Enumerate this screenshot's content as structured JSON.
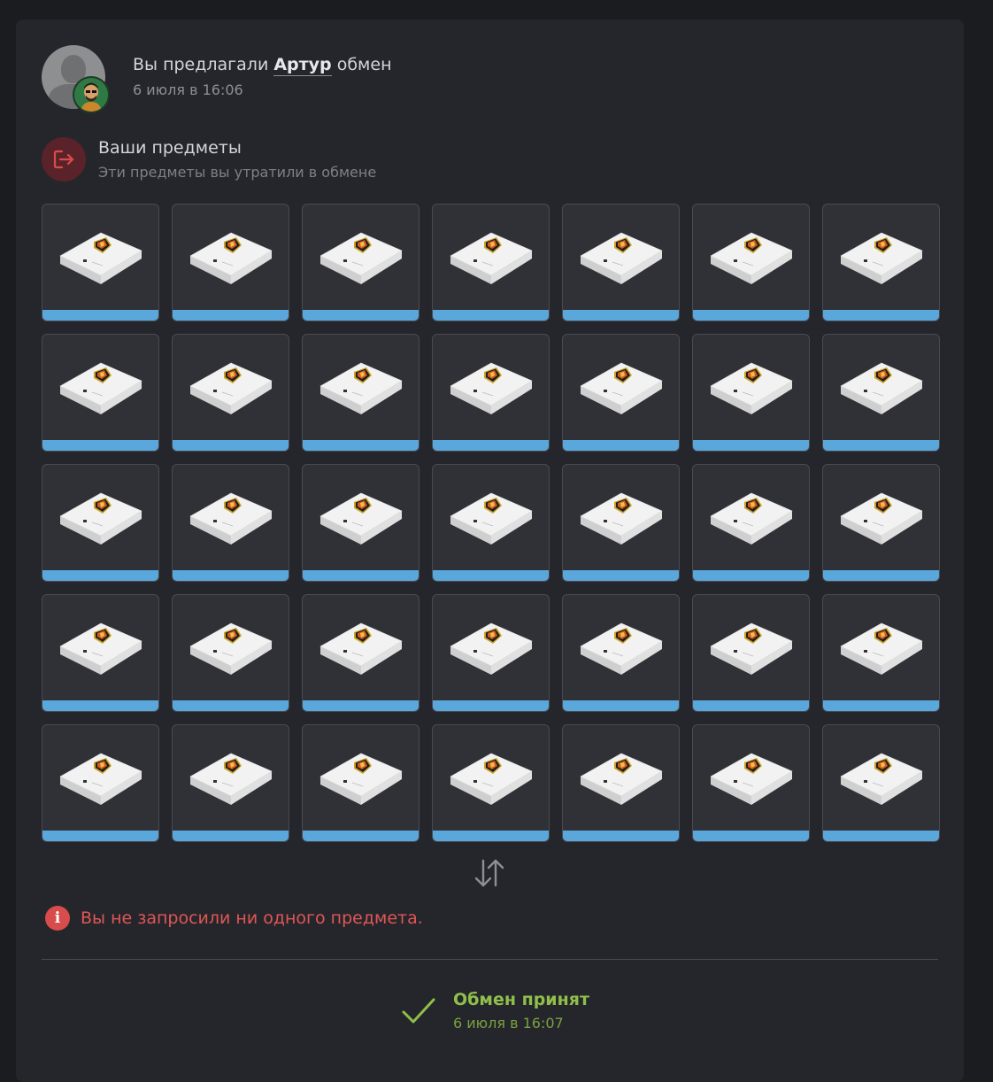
{
  "header": {
    "prefix": "Вы предлагали",
    "user": "Артур",
    "suffix": "обмен",
    "date": "6 июля в 16:06"
  },
  "your_items": {
    "title": "Ваши предметы",
    "subtitle": "Эти предметы вы утратили в обмене",
    "count": 35,
    "item_icon": "case-box",
    "rarity_color": "#5aa7dc"
  },
  "swap_icon": "swap-arrows-icon",
  "notice": {
    "text": "Вы не запросили ни одного предмета.",
    "icon": "info-icon",
    "color": "#e05656"
  },
  "status": {
    "title": "Обмен принят",
    "date": "6 июля в 16:07",
    "icon": "checkmark-icon",
    "color": "#8fbf4a"
  }
}
